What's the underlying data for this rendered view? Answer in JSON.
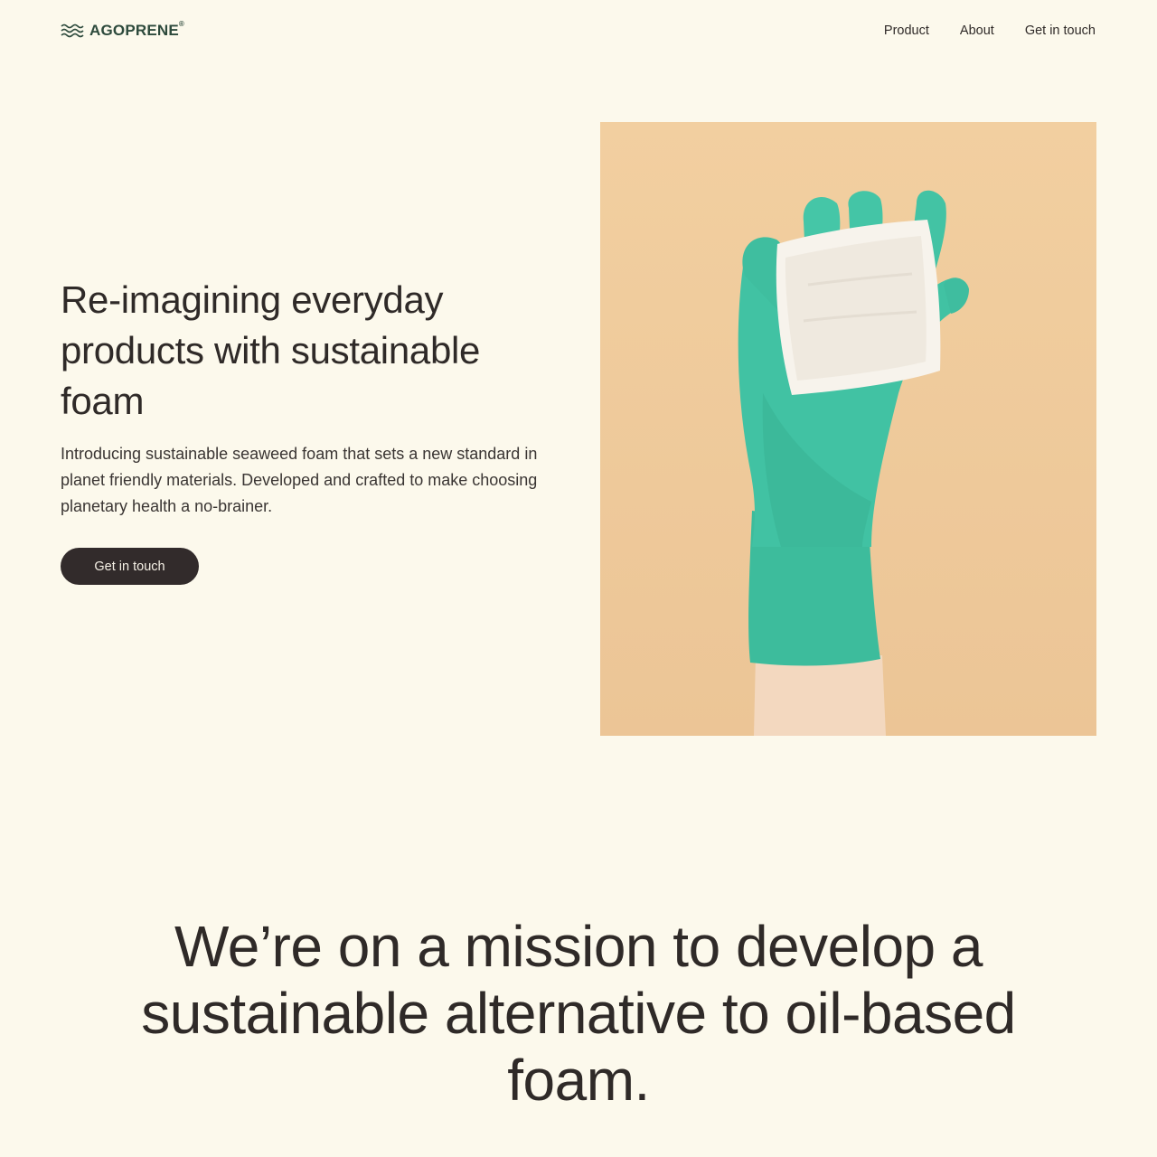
{
  "brand": {
    "name": "AGOPRENE",
    "reg": "®",
    "colors": {
      "brand_green": "#2d4a3c",
      "background": "#fcf9ec",
      "button": "#322b2b",
      "glove": "#3fbd9f"
    }
  },
  "nav": {
    "items": [
      {
        "label": "Product"
      },
      {
        "label": "About"
      },
      {
        "label": "Get in touch"
      }
    ]
  },
  "hero": {
    "title": "Re-imagining everyday products with sustainable foam",
    "subtitle": "Introducing sustainable seaweed foam that sets a new standard in planet friendly materials. Developed and crafted to make choosing planetary health a no-brainer.",
    "cta_label": "Get in touch"
  },
  "mission": {
    "text": "We’re on a mission to develop a sustainable alternative to oil-based foam."
  }
}
